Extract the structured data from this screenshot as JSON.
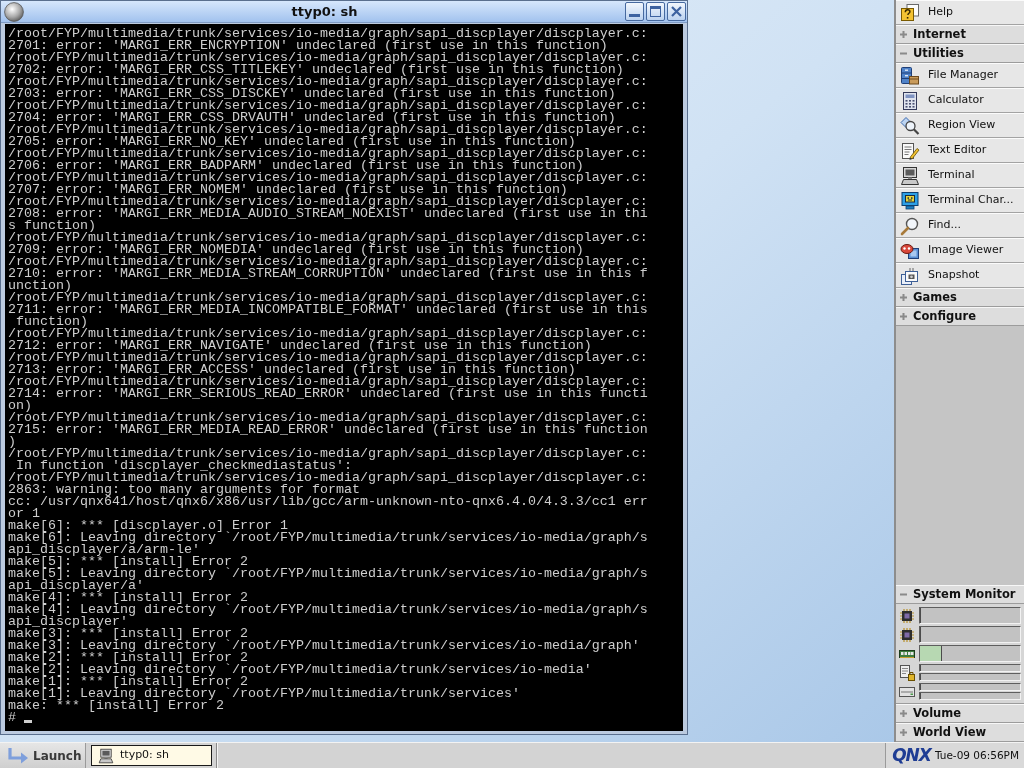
{
  "window": {
    "title": "ttyp0: sh"
  },
  "terminal": {
    "lines": [
      "/root/FYP/multimedia/trunk/services/io-media/graph/sapi_discplayer/discplayer.c:",
      "2701: error: 'MARGI_ERR_ENCRYPTION' undeclared (first use in this function)",
      "/root/FYP/multimedia/trunk/services/io-media/graph/sapi_discplayer/discplayer.c:",
      "2702: error: 'MARGI_ERR_CSS_TITLEKEY' undeclared (first use in this function)",
      "/root/FYP/multimedia/trunk/services/io-media/graph/sapi_discplayer/discplayer.c:",
      "2703: error: 'MARGI_ERR_CSS_DISCKEY' undeclared (first use in this function)",
      "/root/FYP/multimedia/trunk/services/io-media/graph/sapi_discplayer/discplayer.c:",
      "2704: error: 'MARGI_ERR_CSS_DRVAUTH' undeclared (first use in this function)",
      "/root/FYP/multimedia/trunk/services/io-media/graph/sapi_discplayer/discplayer.c:",
      "2705: error: 'MARGI_ERR_NO_KEY' undeclared (first use in this function)",
      "/root/FYP/multimedia/trunk/services/io-media/graph/sapi_discplayer/discplayer.c:",
      "2706: error: 'MARGI_ERR_BADPARM' undeclared (first use in this function)",
      "/root/FYP/multimedia/trunk/services/io-media/graph/sapi_discplayer/discplayer.c:",
      "2707: error: 'MARGI_ERR_NOMEM' undeclared (first use in this function)",
      "/root/FYP/multimedia/trunk/services/io-media/graph/sapi_discplayer/discplayer.c:",
      "2708: error: 'MARGI_ERR_MEDIA_AUDIO_STREAM_NOEXIST' undeclared (first use in thi",
      "s function)",
      "/root/FYP/multimedia/trunk/services/io-media/graph/sapi_discplayer/discplayer.c:",
      "2709: error: 'MARGI_ERR_NOMEDIA' undeclared (first use in this function)",
      "/root/FYP/multimedia/trunk/services/io-media/graph/sapi_discplayer/discplayer.c:",
      "2710: error: 'MARGI_ERR_MEDIA_STREAM_CORRUPTION' undeclared (first use in this f",
      "unction)",
      "/root/FYP/multimedia/trunk/services/io-media/graph/sapi_discplayer/discplayer.c:",
      "2711: error: 'MARGI_ERR_MEDIA_INCOMPATIBLE_FORMAT' undeclared (first use in this",
      " function)",
      "/root/FYP/multimedia/trunk/services/io-media/graph/sapi_discplayer/discplayer.c:",
      "2712: error: 'MARGI_ERR_NAVIGATE' undeclared (first use in this function)",
      "/root/FYP/multimedia/trunk/services/io-media/graph/sapi_discplayer/discplayer.c:",
      "2713: error: 'MARGI_ERR_ACCESS' undeclared (first use in this function)",
      "/root/FYP/multimedia/trunk/services/io-media/graph/sapi_discplayer/discplayer.c:",
      "2714: error: 'MARGI_ERR_SERIOUS_READ_ERROR' undeclared (first use in this functi",
      "on)",
      "/root/FYP/multimedia/trunk/services/io-media/graph/sapi_discplayer/discplayer.c:",
      "2715: error: 'MARGI_ERR_MEDIA_READ_ERROR' undeclared (first use in this function",
      ")",
      "/root/FYP/multimedia/trunk/services/io-media/graph/sapi_discplayer/discplayer.c:",
      " In function 'discplayer_checkmediastatus':",
      "/root/FYP/multimedia/trunk/services/io-media/graph/sapi_discplayer/discplayer.c:",
      "2863: warning: too many arguments for format",
      "cc: /usr/qnx641/host/qnx6/x86/usr/lib/gcc/arm-unknown-nto-qnx6.4.0/4.3.3/cc1 err",
      "or 1",
      "make[6]: *** [discplayer.o] Error 1",
      "make[6]: Leaving directory `/root/FYP/multimedia/trunk/services/io-media/graph/s",
      "api_discplayer/a/arm-le'",
      "make[5]: *** [install] Error 2",
      "make[5]: Leaving directory `/root/FYP/multimedia/trunk/services/io-media/graph/s",
      "api_discplayer/a'",
      "make[4]: *** [install] Error 2",
      "make[4]: Leaving directory `/root/FYP/multimedia/trunk/services/io-media/graph/s",
      "api_discplayer'",
      "make[3]: *** [install] Error 2",
      "make[3]: Leaving directory `/root/FYP/multimedia/trunk/services/io-media/graph'",
      "make[2]: *** [install] Error 2",
      "make[2]: Leaving directory `/root/FYP/multimedia/trunk/services/io-media'",
      "make[1]: *** [install] Error 2",
      "make[1]: Leaving directory `/root/FYP/multimedia/trunk/services'",
      "make: *** [install] Error 2"
    ],
    "prompt": "#"
  },
  "shelf": {
    "upper_items": [
      {
        "kind": "launcher",
        "label": "Help"
      },
      {
        "kind": "group",
        "label": "Internet",
        "expanded": false
      },
      {
        "kind": "group",
        "label": "Utilities",
        "expanded": true,
        "children": [
          {
            "label": "File Manager"
          },
          {
            "label": "Calculator"
          },
          {
            "label": "Region View"
          },
          {
            "label": "Text Editor"
          },
          {
            "label": "Terminal"
          },
          {
            "label": "Terminal Char..."
          },
          {
            "label": "Find..."
          },
          {
            "label": "Image Viewer"
          },
          {
            "label": "Snapshot"
          }
        ]
      },
      {
        "kind": "group",
        "label": "Games",
        "expanded": false
      },
      {
        "kind": "group",
        "label": "Configure",
        "expanded": false
      }
    ],
    "lower_items": [
      {
        "kind": "monitor",
        "label": "System Monitor",
        "expanded": true,
        "meters": [
          {
            "bars": [
              {
                "level": 0
              }
            ]
          },
          {
            "bars": [
              {
                "level": 0
              }
            ]
          },
          {
            "bars": [
              {
                "level": 0.22
              }
            ]
          },
          {
            "bars": [
              {
                "level": 0
              },
              {
                "level": 0
              }
            ]
          },
          {
            "bars": [
              {
                "level": 0
              },
              {
                "level": 0
              }
            ]
          }
        ]
      },
      {
        "kind": "group",
        "label": "Volume",
        "expanded": false
      },
      {
        "kind": "group",
        "label": "World View",
        "expanded": false
      }
    ]
  },
  "taskbar": {
    "launch": "Launch",
    "tasks": [
      {
        "label": "ttyp0: sh",
        "selected": true
      }
    ],
    "logo": "QNX",
    "clock": "Tue-09 06:56PM"
  }
}
